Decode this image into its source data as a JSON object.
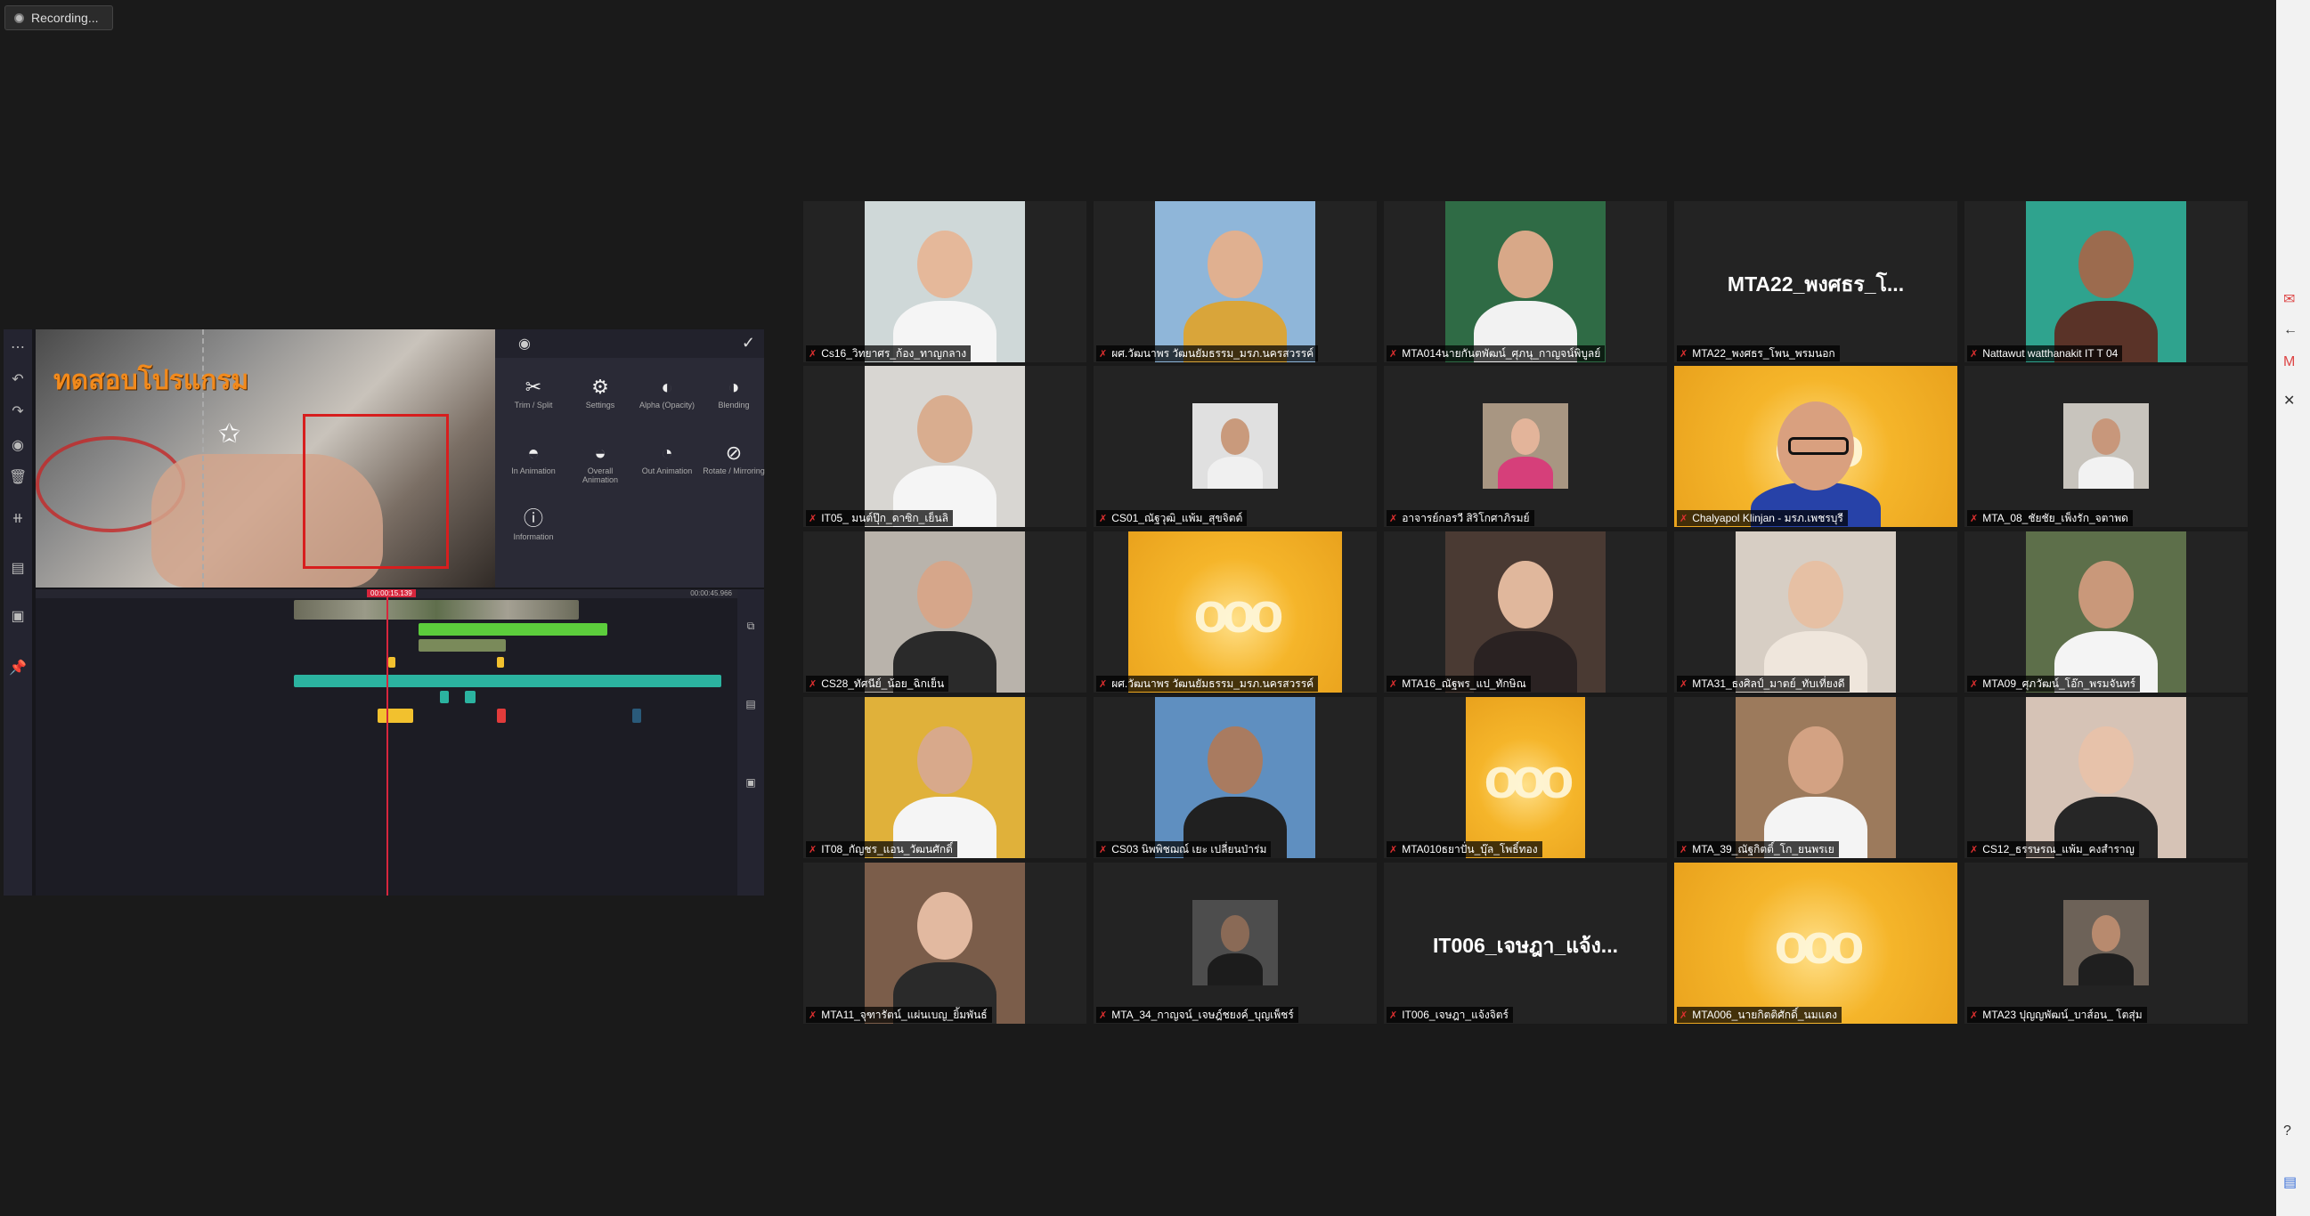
{
  "recording": {
    "label": "Recording..."
  },
  "editor": {
    "preview_title": "ทดสอบโปรแกรม",
    "tools": [
      {
        "label": "Trim / Split",
        "icon": "scissors-icon",
        "glyph": "✂"
      },
      {
        "label": "Settings",
        "icon": "gear-icon",
        "glyph": "⚙"
      },
      {
        "label": "Alpha (Opacity)",
        "icon": "opacity-icon",
        "glyph": "◐"
      },
      {
        "label": "Blending",
        "icon": "blending-icon",
        "glyph": "◑"
      },
      {
        "label": "In Animation",
        "icon": "in-animation-icon",
        "glyph": "◓"
      },
      {
        "label": "Overall Animation",
        "icon": "overall-animation-icon",
        "glyph": "◒"
      },
      {
        "label": "Out Animation",
        "icon": "out-animation-icon",
        "glyph": "◔"
      },
      {
        "label": "Rotate / Mirroring",
        "icon": "rotate-icon",
        "glyph": "⊘"
      },
      {
        "label": "Information",
        "icon": "info-icon",
        "glyph": "ⓘ"
      }
    ],
    "timecode": "00:00:15.139",
    "duration": "00:00:45.966"
  },
  "participants": [
    {
      "name": "Cs16_วิทยาศร_ก้อง_ทาญกลาง",
      "kind": "video",
      "bg": "#cfd8d8",
      "skin": "#e5b89a",
      "shirt": "#f5f5f5"
    },
    {
      "name": "ผศ.วัฒนาพร วัฒนยัมธรรม_มรภ.นครสวรรค์",
      "kind": "video",
      "bg": "#8fb6d9",
      "skin": "#e0b090",
      "shirt": "#d9a53a"
    },
    {
      "name": "MTA014นายกันตพัฒน์_ศุภนุ_กาญจน์พิบูลย์",
      "kind": "video",
      "bg": "#2f6b45",
      "skin": "#d8a888",
      "shirt": "#f2f2f2"
    },
    {
      "name": "MTA22_พงศธร_โพน_พรมนอก",
      "kind": "name",
      "big": "MTA22_พงศธร_โ..."
    },
    {
      "name": "Nattawut watthanakit IT T 04",
      "kind": "video",
      "bg": "#2fa38e",
      "skin": "#9c6b4e",
      "shirt": "#5a3328"
    },
    {
      "name": "IT05_ มนต์ปุ๊ก_ดาซิก_เย็นลิ",
      "kind": "video",
      "bg": "#d8d6d2",
      "skin": "#d9ad8f",
      "shirt": "#f5f5f5"
    },
    {
      "name": "CS01_ณัฐวุฒิ_แพ้ม_สุขจิตต์",
      "kind": "small",
      "bg": "#e0e0e0",
      "skin": "#c99a7c",
      "shirt": "#f0f0f0"
    },
    {
      "name": "อาจารย์กอรวี สิริโกศาภิรมย์",
      "kind": "small",
      "bg": "#a89682",
      "skin": "#e3b49a",
      "shirt": "#d63f7a"
    },
    {
      "name": "Chalyapol Klinjan - มรภ.เพชรบุรี",
      "kind": "gold",
      "active": true
    },
    {
      "name": "MTA_08_ชัยชัย_เพ็งรัก_จตาพด",
      "kind": "small",
      "bg": "#c8c4bd",
      "skin": "#c8977b",
      "shirt": "#f2f2f2"
    },
    {
      "name": "CS28_ทัศนีย์_น้อย_ฉิกเย็น",
      "kind": "video",
      "bg": "#b9b3ab",
      "skin": "#d6a68a",
      "shirt": "#2a2a2a"
    },
    {
      "name": "ผศ.วัฒนาพร วัฒนยัมธรรม_มรภ.นครสวรรค์",
      "kind": "gold"
    },
    {
      "name": "MTA16_ณัฐพร_แป_ทักษิณ",
      "kind": "video",
      "bg": "#4a3a33",
      "skin": "#e0b79c",
      "shirt": "#2a2222"
    },
    {
      "name": "MTA31_ธงศิลป์_มาตย์_ทับเที่ยงดี",
      "kind": "video",
      "bg": "#d7cec4",
      "skin": "#e6c0a4",
      "shirt": "#efe6dc"
    },
    {
      "name": "MTA09_ศุภวัฒน์_โอ๊ก_พรมจันทร์",
      "kind": "video",
      "bg": "#5d6f4a",
      "skin": "#c9987a",
      "shirt": "#f4f4f4"
    },
    {
      "name": "IT08_กัญชร_แอน_วัฒนศักดิ์",
      "kind": "video",
      "bg": "#e0b13a",
      "skin": "#d8a98b",
      "shirt": "#f5f5f5"
    },
    {
      "name": "CS03 นิพพิชฌณ์ เยะ เปลี่ยนป่าร่ม",
      "kind": "video",
      "bg": "#5f8fc0",
      "skin": "#a97b60",
      "shirt": "#202020"
    },
    {
      "name": "MTA010ธยาปั่น_บุ๊ล_โพธิ์ทอง",
      "kind": "gold"
    },
    {
      "name": "MTA_39_ณัฐกิตติ์_โก_ยนพรเย",
      "kind": "video",
      "bg": "#9c7a5c",
      "skin": "#d3a283",
      "shirt": "#f4f4f4"
    },
    {
      "name": "CS12_ธรรษรณ_แพ้ม_คงสำราญ",
      "kind": "video",
      "bg": "#d6c3b6",
      "skin": "#e7c2aa",
      "shirt": "#262626"
    },
    {
      "name": "MTA11_จุฑารัตน์_แผ่นเบญ_ยิ้มพันธ์",
      "kind": "video",
      "bg": "#7b5d4a",
      "skin": "#e2b9a0",
      "shirt": "#2a2a2a"
    },
    {
      "name": "MTA_34_กาญจน์_เจษฎ์ชยงค์_บุญเพ็ชร์",
      "kind": "small",
      "bg": "#4d4d4d",
      "skin": "#8a6a56",
      "shirt": "#1c1c1c"
    },
    {
      "name": "IT006_เจษฎา_แจ้งจิตร์",
      "kind": "name",
      "big": "IT006_เจษฎา_แจ้ง..."
    },
    {
      "name": "MTA006_นายกิตติศักดิ์_นมแดง",
      "kind": "gold"
    },
    {
      "name": "MTA23 ปุญญพัฒน์_บาส์อน_ โตสุ่ม",
      "kind": "small",
      "bg": "#6d6258",
      "skin": "#b88a6e",
      "shirt": "#1f1f1f"
    }
  ],
  "side_strip": {
    "icons": [
      "mail-icon",
      "back-arrow-icon",
      "gmail-icon",
      "close-icon",
      "help-icon",
      "doc-icon"
    ]
  }
}
